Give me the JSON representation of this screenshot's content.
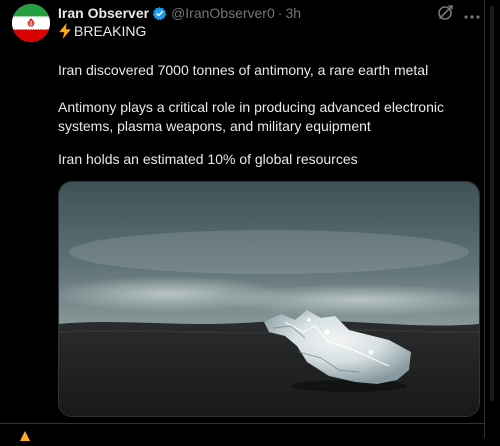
{
  "tweet": {
    "author_name": "Iran Observer",
    "handle": "@IranObserver0",
    "separator": "·",
    "time": "3h",
    "breaking": "BREAKING",
    "paragraphs": [
      "Iran discovered 7000 tonnes of antimony, a rare earth metal",
      "Antimony plays a critical role in producing advanced electronic systems, plasma weapons, and military equipment",
      "Iran holds an estimated 10% of global resources"
    ]
  },
  "icons": {
    "avatar": "iran-flag",
    "verified": "verified-badge-icon",
    "breaking": "lightning-bolt-icon",
    "grok": "grok-icon",
    "more": "more-options-icon",
    "next": "emoji-icon"
  },
  "colors": {
    "background": "#000000",
    "text": "#e7e9ea",
    "secondary_text": "#71767b",
    "verified": "#1d9bf0",
    "bolt": "#ffad1f",
    "border": "#2f3336"
  }
}
